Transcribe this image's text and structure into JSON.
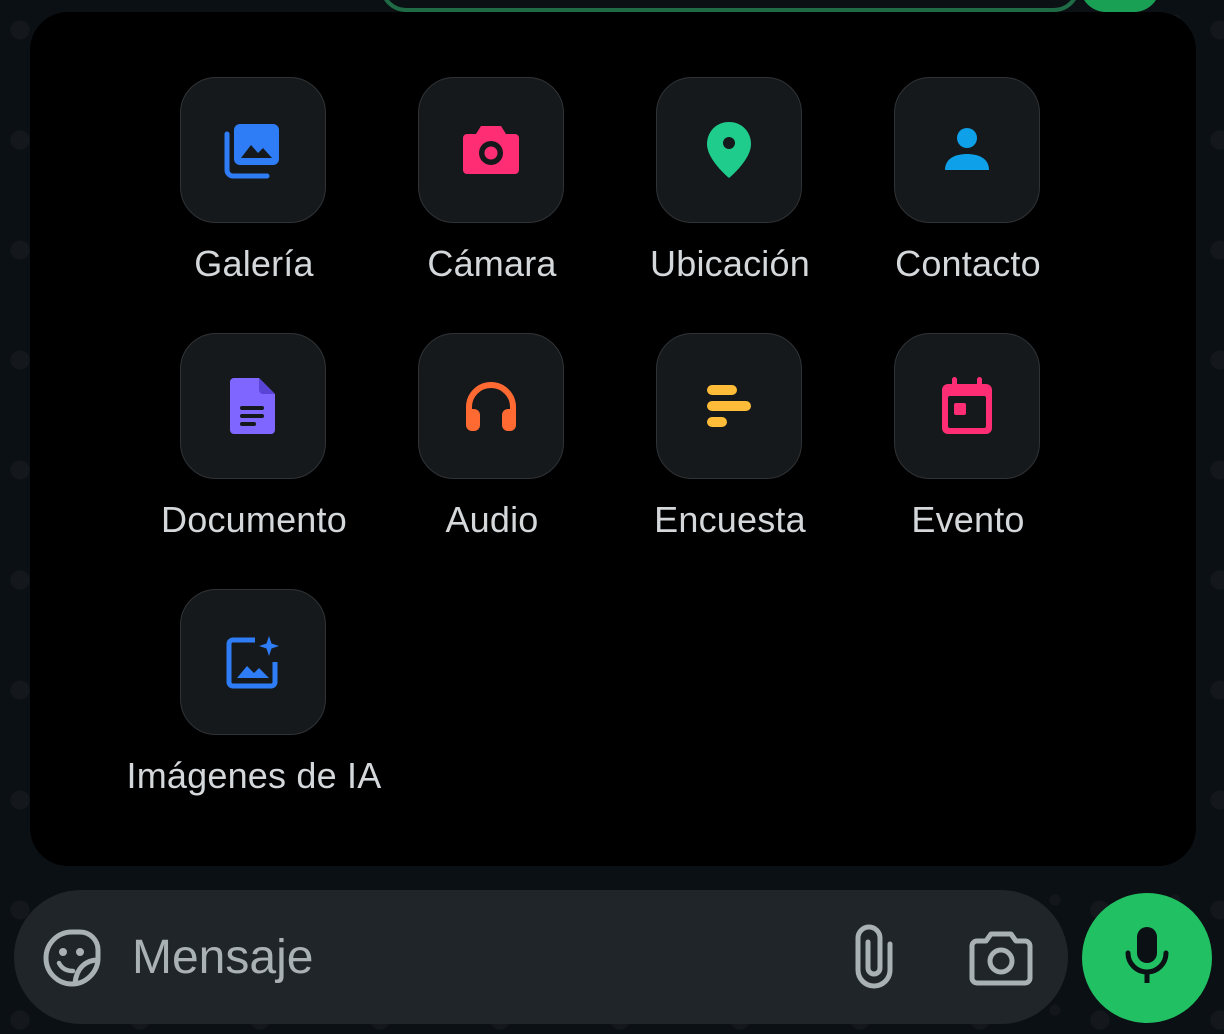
{
  "attach_menu": {
    "items": [
      {
        "label": "Galería",
        "icon": "gallery-icon",
        "color": "#2f7df6"
      },
      {
        "label": "Cámara",
        "icon": "camera-icon",
        "color": "#ff2e74"
      },
      {
        "label": "Ubicación",
        "icon": "location-icon",
        "color": "#1fcc8c"
      },
      {
        "label": "Contacto",
        "icon": "contact-icon",
        "color": "#0ea0e8"
      },
      {
        "label": "Documento",
        "icon": "document-icon",
        "color": "#7f66ff"
      },
      {
        "label": "Audio",
        "icon": "headphones-icon",
        "color": "#ff6a33"
      },
      {
        "label": "Encuesta",
        "icon": "poll-icon",
        "color": "#ffbc38"
      },
      {
        "label": "Evento",
        "icon": "calendar-icon",
        "color": "#ff2e74"
      },
      {
        "label": "Imágenes de IA",
        "icon": "ai-image-icon",
        "color": "#2f7df6"
      }
    ]
  },
  "composer": {
    "placeholder": "Mensaje",
    "emoji_icon": "sticker-icon",
    "attach_icon": "paperclip-icon",
    "camera_icon": "camera-icon",
    "mic_icon": "microphone-icon",
    "mic_color": "#21c063"
  }
}
